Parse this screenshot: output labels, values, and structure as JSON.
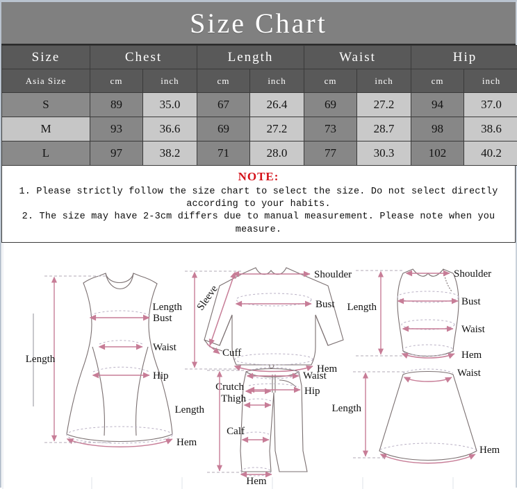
{
  "header": {
    "title": "Size Chart"
  },
  "table": {
    "main_headers": [
      "Size",
      "Chest",
      "Length",
      "Waist",
      "Hip"
    ],
    "sub_headers": [
      "Asia Size",
      "cm",
      "inch",
      "cm",
      "inch",
      "cm",
      "inch",
      "cm",
      "inch"
    ],
    "rows": [
      {
        "size": "S",
        "chest_cm": "89",
        "chest_in": "35.0",
        "length_cm": "67",
        "length_in": "26.4",
        "waist_cm": "69",
        "waist_in": "27.2",
        "hip_cm": "94",
        "hip_in": "37.0"
      },
      {
        "size": "M",
        "chest_cm": "93",
        "chest_in": "36.6",
        "length_cm": "69",
        "length_in": "27.2",
        "waist_cm": "73",
        "waist_in": "28.7",
        "hip_cm": "98",
        "hip_in": "38.6"
      },
      {
        "size": "L",
        "chest_cm": "97",
        "chest_in": "38.2",
        "length_cm": "71",
        "length_in": "28.0",
        "waist_cm": "77",
        "waist_in": "30.3",
        "hip_cm": "102",
        "hip_in": "40.2"
      }
    ]
  },
  "note": {
    "title": "NOTE:",
    "line1": "1. Please strictly follow the size chart  to select the size. Do not select directly",
    "line2": "according to your habits.",
    "line3": "2. The size may have 2-3cm differs due to manual measurement. Please note when you measure."
  },
  "diagrams": {
    "dress": {
      "length": "Length",
      "bust": "Bust",
      "waist": "Waist",
      "hip": "Hip",
      "hem": "Hem"
    },
    "top": {
      "length": "Length",
      "sleeve": "Sleeve",
      "shoulder": "Shoulder",
      "bust": "Bust",
      "cuff": "Cuff",
      "hem": "Hem"
    },
    "tank": {
      "length": "Length",
      "shoulder": "Shoulder",
      "bust": "Bust",
      "waist": "Waist",
      "hem": "Hem"
    },
    "pants": {
      "length": "Length",
      "waist": "Waist",
      "hip": "Hip",
      "crutch": "Crutch",
      "thigh": "Thigh",
      "calf": "Calf",
      "hem": "Hem"
    },
    "skirt": {
      "length": "Length",
      "waist": "Waist",
      "hem": "Hem"
    }
  },
  "colors": {
    "title_bar": "#808080",
    "header_cell": "#595959",
    "cm_cell": "#878787",
    "inch_cell": "#c9c9c9",
    "note_accent": "#d4121a",
    "measure_line": "#c77d97",
    "garment_outline": "#7a6f70"
  }
}
